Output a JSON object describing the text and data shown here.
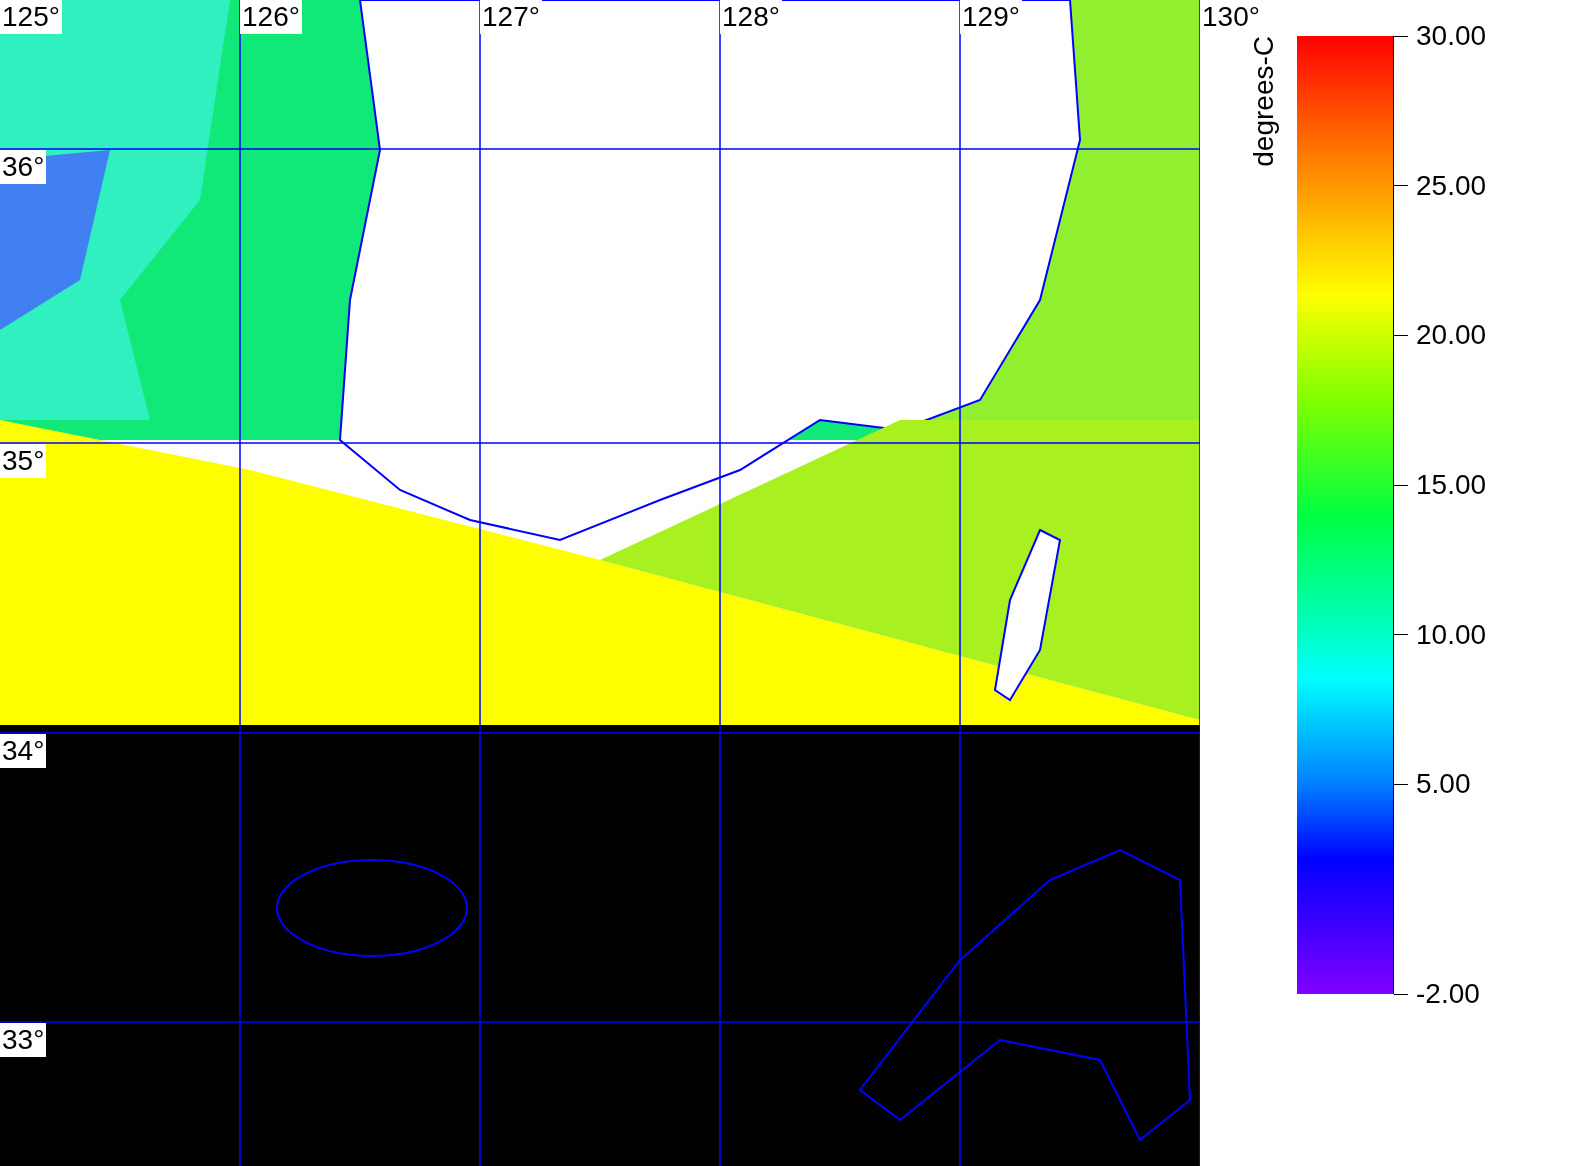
{
  "map": {
    "longitude_labels": [
      "125°",
      "126°",
      "127°",
      "128°",
      "129°",
      "130°"
    ],
    "latitude_labels": [
      "36°",
      "35°",
      "34°",
      "33°"
    ]
  },
  "colorbar": {
    "title": "degrees-C",
    "ticks": [
      "30.00",
      "25.00",
      "20.00",
      "15.00",
      "10.00",
      "5.00",
      "-2.00"
    ]
  }
}
